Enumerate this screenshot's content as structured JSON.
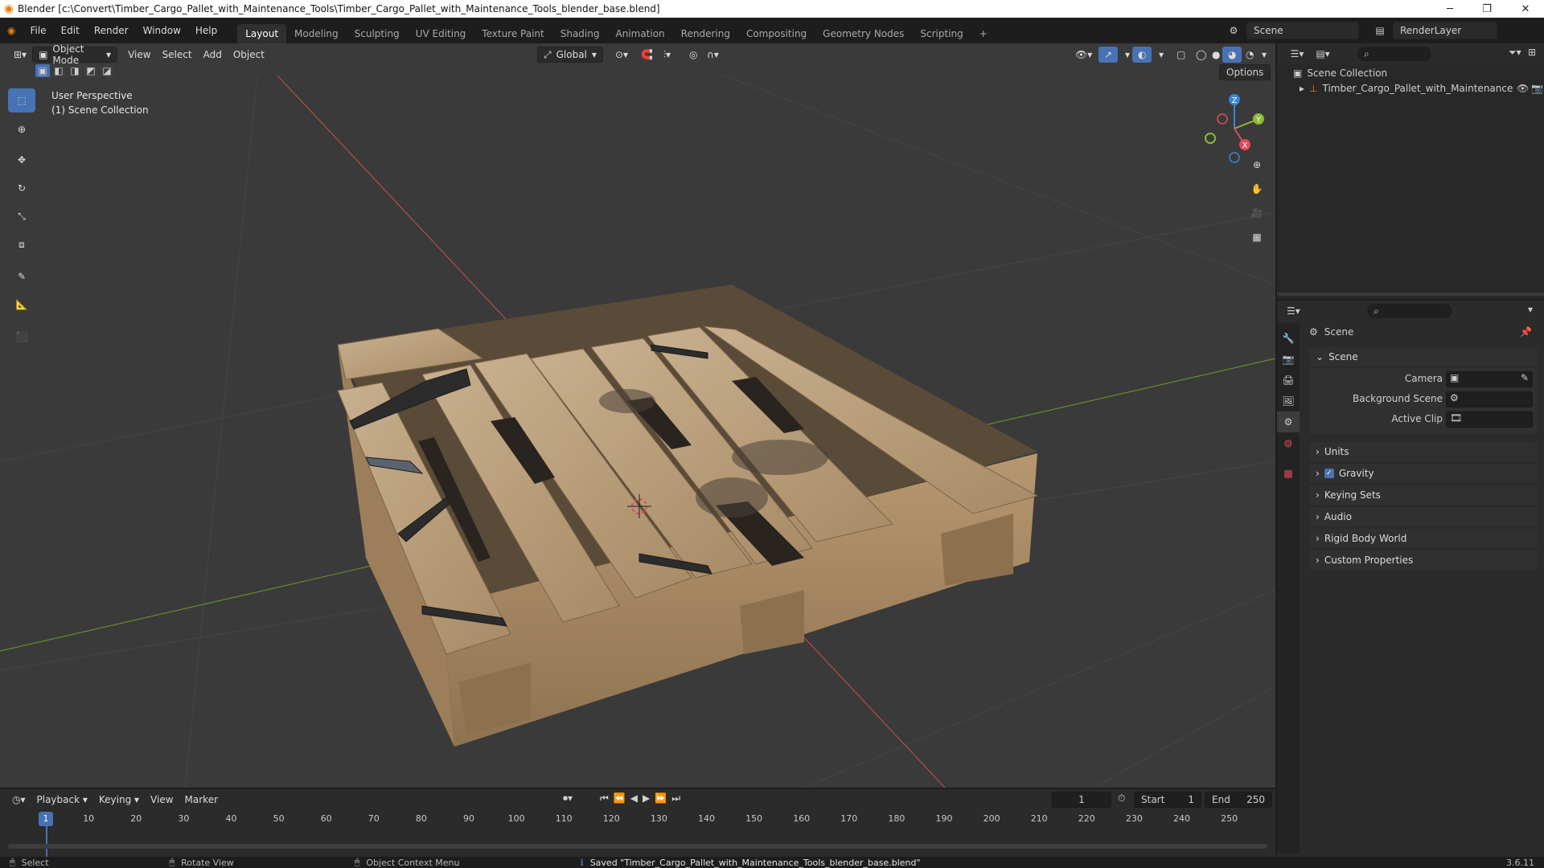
{
  "title_bar": {
    "title": "Blender [c:\\Convert\\Timber_Cargo_Pallet_with_Maintenance_Tools\\Timber_Cargo_Pallet_with_Maintenance_Tools_blender_base.blend]",
    "minimize": "─",
    "maximize": "❐",
    "close": "✕"
  },
  "menu": {
    "items": [
      "File",
      "Edit",
      "Render",
      "Window",
      "Help"
    ],
    "workspaces": [
      "Layout",
      "Modeling",
      "Sculpting",
      "UV Editing",
      "Texture Paint",
      "Shading",
      "Animation",
      "Rendering",
      "Compositing",
      "Geometry Nodes",
      "Scripting"
    ],
    "active_workspace": "Layout",
    "add_workspace": "+",
    "scene_name": "Scene",
    "render_layer": "RenderLayer"
  },
  "viewport": {
    "mode": "Object Mode",
    "menus": [
      "View",
      "Select",
      "Add",
      "Object"
    ],
    "transform_orientation": "Global",
    "options_label": "Options",
    "overlay_line1": "User Perspective",
    "overlay_line2": "(1) Scene Collection",
    "gizmo": {
      "x": "X",
      "y": "Y",
      "z": "Z"
    }
  },
  "outliner": {
    "root": "Scene Collection",
    "items": [
      {
        "name": "Timber_Cargo_Pallet_with_Maintenance"
      }
    ]
  },
  "properties": {
    "header": "Scene",
    "panel_title": "Scene",
    "fields": {
      "camera_label": "Camera",
      "background_scene_label": "Background Scene",
      "active_clip_label": "Active Clip"
    },
    "sections": [
      "Units",
      "Gravity",
      "Keying Sets",
      "Audio",
      "Rigid Body World",
      "Custom Properties"
    ],
    "gravity_checked": true
  },
  "timeline": {
    "menus": [
      "Playback",
      "Keying",
      "View",
      "Marker"
    ],
    "current_frame": "1",
    "start_label": "Start",
    "start_value": "1",
    "end_label": "End",
    "end_value": "250",
    "ruler_current": "1",
    "ruler_ticks": [
      "10",
      "20",
      "30",
      "40",
      "50",
      "60",
      "70",
      "80",
      "90",
      "100",
      "110",
      "120",
      "130",
      "140",
      "150",
      "160",
      "170",
      "180",
      "190",
      "200",
      "210",
      "220",
      "230",
      "240",
      "250"
    ]
  },
  "status_bar": {
    "select": "Select",
    "rotate_view": "Rotate View",
    "context_menu": "Object Context Menu",
    "message": "Saved \"Timber_Cargo_Pallet_with_Maintenance_Tools_blender_base.blend\"",
    "version": "3.6.11"
  },
  "colors": {
    "accent": "#4772b3",
    "x_axis": "#e04a5a",
    "y_axis": "#8cba31",
    "z_axis": "#3c84d8",
    "blender_orange": "#e87d0d"
  }
}
